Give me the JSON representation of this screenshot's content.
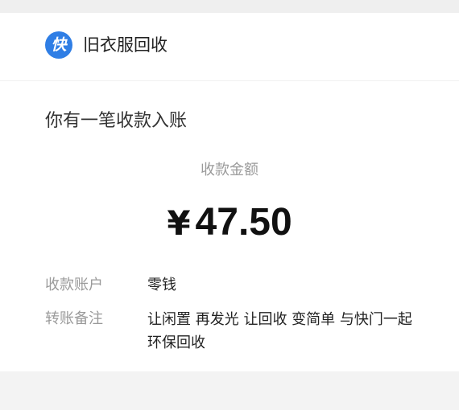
{
  "header": {
    "logo_text": "快",
    "app_name": "旧衣服回收"
  },
  "notice": {
    "title": "你有一笔收款入账"
  },
  "payment": {
    "amount_label": "收款金额",
    "currency_symbol": "¥",
    "amount": "47.50"
  },
  "details": {
    "account_label": "收款账户",
    "account_value": "零钱",
    "remark_label": "转账备注",
    "remark_value": "让闲置 再发光 让回收 变简单 与快门一起环保回收"
  },
  "colors": {
    "brand_blue": "#2f7ee5",
    "muted_text": "#9a9a9a",
    "primary_text": "#222222",
    "background": "#f3f3f3",
    "card_background": "#ffffff"
  }
}
